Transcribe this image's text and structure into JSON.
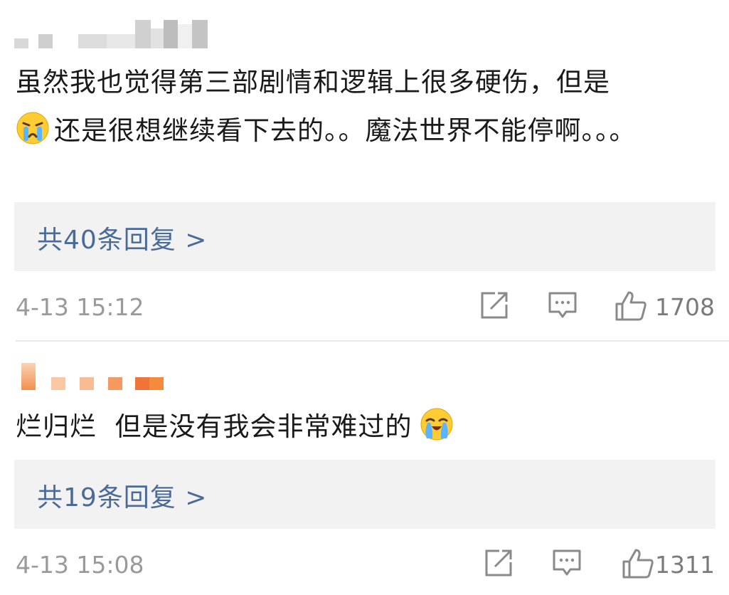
{
  "comments": [
    {
      "text_part1": "虽然我也觉得第三部剧情和逻辑上很多硬伤，但是",
      "text_part2": "还是很想继续看下去的。。魔法世界不能停啊。。。",
      "emoji": "crying-face-icon",
      "replies_label": "共40条回复 >",
      "time": "4-13 15:12",
      "likes": "1708"
    },
    {
      "text": "烂归烂  但是没有我会非常难过的",
      "emoji": "crying-face-icon",
      "replies_label": "共19条回复 >",
      "time": "4-13 15:08",
      "likes": "1311"
    }
  ],
  "colors": {
    "reply_link": "#4a6a98",
    "meta_text": "#9a9a9a",
    "reply_bg": "#f2f2f2",
    "username_blur_1": "#bdbdbd",
    "username_blur_2": "#f08a4b"
  }
}
